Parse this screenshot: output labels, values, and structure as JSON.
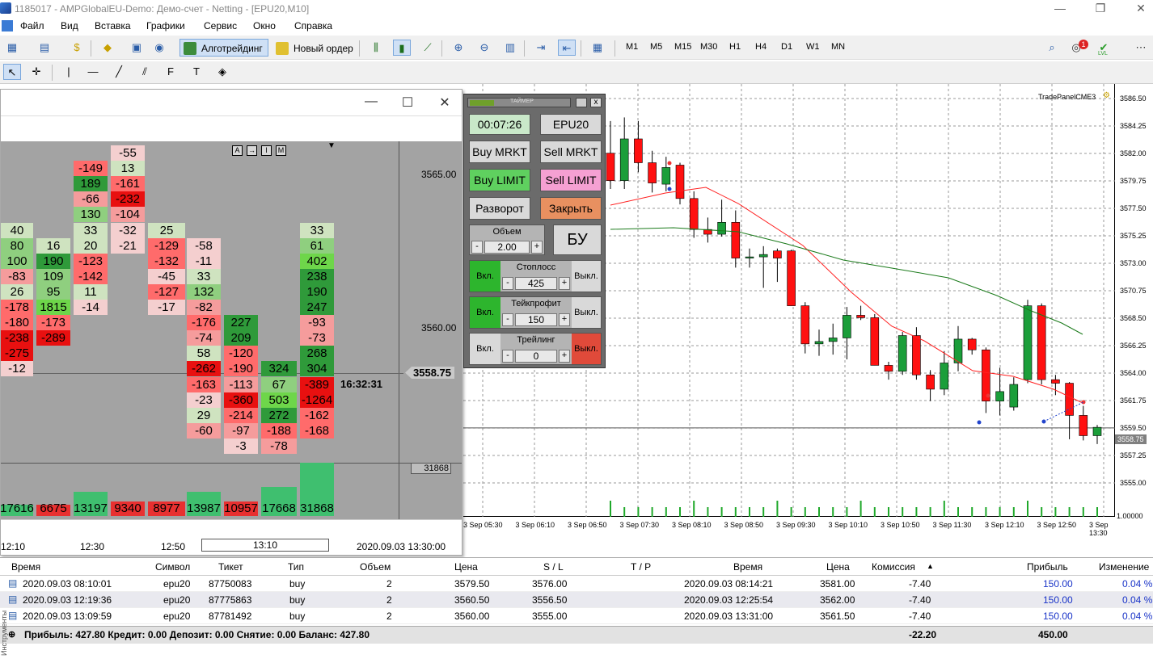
{
  "window": {
    "title": "1185017 - AMPGlobalEU-Demo: Демо-счет - Netting - [EPU20,M10]"
  },
  "menu": [
    "Файл",
    "Вид",
    "Вставка",
    "Графики",
    "Сервис",
    "Окно",
    "Справка"
  ],
  "toolbar": {
    "algotrading": "Алготрейдинг",
    "new_order": "Новый ордер",
    "timeframes": [
      "M1",
      "M5",
      "M15",
      "M30",
      "H1",
      "H4",
      "D1",
      "W1",
      "MN"
    ],
    "notif_count": "1",
    "lvl": "LVL"
  },
  "chart": {
    "tag": "TradePanelCME3",
    "current_price": "3558.75",
    "price_labels": [
      "3586.50",
      "3584.25",
      "3582.00",
      "3579.75",
      "3577.50",
      "3575.25",
      "3573.00",
      "3570.75",
      "3568.50",
      "3566.25",
      "3564.00",
      "3561.75",
      "3559.50",
      "3557.25",
      "3555.00"
    ],
    "volume_axis": "1.00000",
    "time_labels": [
      "3 Sep 05:30",
      "3 Sep 06:10",
      "3 Sep 06:50",
      "3 Sep 07:30",
      "3 Sep 08:10",
      "3 Sep 08:50",
      "3 Sep 09:30",
      "3 Sep 10:10",
      "3 Sep 10:50",
      "3 Sep 11:30",
      "3 Sep 12:10",
      "3 Sep 12:50",
      "3 Sep 13:30"
    ]
  },
  "trade_panel": {
    "timer_label": "ТАЙМЕР",
    "timer": "00:07:26",
    "symbol": "EPU20",
    "buy_market": "Buy MRKT",
    "sell_market": "Sell MRKT",
    "buy_limit": "Buy LIMIT",
    "sell_limit": "Sell LIMIT",
    "reverse": "Разворот",
    "close": "Закрыть",
    "volume_label": "Объем",
    "volume": "2.00",
    "bu": "БУ",
    "on": "Вкл.",
    "off": "Выкл.",
    "stoploss_label": "Стоплосс",
    "stoploss": "425",
    "takeprofit_label": "Тейкпрофит",
    "takeprofit": "150",
    "trailing_label": "Трейлинг",
    "trailing": "0",
    "minus": "-",
    "plus": "+",
    "close_x": "x"
  },
  "footprint": {
    "buttons": [
      "A",
      "→",
      "I",
      "M"
    ],
    "price_top": "3565.00",
    "price_mid": "3560.00",
    "price_current": "3558.75",
    "time_now": "16:32:31",
    "volume_box": "31868",
    "volumes": [
      "17616",
      "6675",
      "13197",
      "9340",
      "8977",
      "13987",
      "10957",
      "17668",
      "31868"
    ],
    "times": [
      "12:10",
      "12:30",
      "12:50",
      "13:10"
    ],
    "datetime": "2020.09.03 13:30:00",
    "columns": [
      [
        "40",
        "80",
        "100",
        "-83",
        "26",
        "-178",
        "-180",
        "-238",
        "-275",
        "-12"
      ],
      [
        "16",
        "190",
        "109",
        "95",
        "1815",
        "-173",
        "-289"
      ],
      [
        "-149",
        "189",
        "-66",
        "130",
        "33",
        "20",
        "-123",
        "-142",
        "11",
        "-14"
      ],
      [
        "-55",
        "13",
        "-161",
        "-232",
        "-104",
        "-32",
        "-21"
      ],
      [
        "25",
        "-129",
        "-132",
        "-45",
        "-127",
        "-17"
      ],
      [
        "-58",
        "-11",
        "33",
        "132",
        "-82",
        "-176",
        "-74",
        "58",
        "-262",
        "-163",
        "-23",
        "29",
        "-60"
      ],
      [
        "227",
        "209",
        "-120",
        "-190",
        "-113",
        "-360",
        "-214",
        "-97",
        "-3"
      ],
      [
        "324",
        "67",
        "503",
        "272",
        "-188",
        "-78"
      ],
      [
        "33",
        "61",
        "402",
        "238",
        "190",
        "247",
        "-93",
        "-73",
        "268",
        "304",
        "-389",
        "-1264",
        "-162",
        "-168"
      ]
    ]
  },
  "terminal": {
    "headers": [
      "Время",
      "Символ",
      "Тикет",
      "Тип",
      "Объем",
      "Цена",
      "S / L",
      "T / P",
      "Время",
      "Цена",
      "Комиссия",
      "Прибыль",
      "Изменение"
    ],
    "rows": [
      {
        "open_time": "2020.09.03 08:10:01",
        "symbol": "epu20",
        "ticket": "87750083",
        "type": "buy",
        "volume": "2",
        "price": "3579.50",
        "sl": "3576.00",
        "tp": "",
        "close_time": "2020.09.03 08:14:21",
        "close_price": "3581.00",
        "commission": "-7.40",
        "profit": "150.00",
        "change": "0.04 %"
      },
      {
        "open_time": "2020.09.03 12:19:36",
        "symbol": "epu20",
        "ticket": "87775863",
        "type": "buy",
        "volume": "2",
        "price": "3560.50",
        "sl": "3556.50",
        "tp": "",
        "close_time": "2020.09.03 12:25:54",
        "close_price": "3562.00",
        "commission": "-7.40",
        "profit": "150.00",
        "change": "0.04 %"
      },
      {
        "open_time": "2020.09.03 13:09:59",
        "symbol": "epu20",
        "ticket": "87781492",
        "type": "buy",
        "volume": "2",
        "price": "3560.00",
        "sl": "3555.00",
        "tp": "",
        "close_time": "2020.09.03 13:31:00",
        "close_price": "3561.50",
        "commission": "-7.40",
        "profit": "150.00",
        "change": "0.04 %"
      }
    ],
    "summary": "Прибыль: 427.80  Кредит: 0.00  Депозит: 0.00  Снятие: 0.00  Баланс: 427.80",
    "total_commission": "-22.20",
    "total_profit": "450.00",
    "side_tab": "Инструменты"
  },
  "candles": [
    {
      "o": 3581.8,
      "h": 3584.5,
      "l": 3578.8,
      "c": 3579.5
    },
    {
      "o": 3579.5,
      "h": 3584.8,
      "l": 3578.8,
      "c": 3583.0
    },
    {
      "o": 3583.0,
      "h": 3584.5,
      "l": 3580.2,
      "c": 3581.0
    },
    {
      "o": 3581.0,
      "h": 3582.0,
      "l": 3578.5,
      "c": 3579.3
    },
    {
      "o": 3579.2,
      "h": 3581.5,
      "l": 3578.6,
      "c": 3580.6
    },
    {
      "o": 3580.8,
      "h": 3581.0,
      "l": 3577.5,
      "c": 3578.0
    },
    {
      "o": 3578.0,
      "h": 3578.6,
      "l": 3574.7,
      "c": 3575.4
    },
    {
      "o": 3575.4,
      "h": 3576.4,
      "l": 3574.3,
      "c": 3575.0
    },
    {
      "o": 3575.0,
      "h": 3577.9,
      "l": 3574.8,
      "c": 3576.0
    },
    {
      "o": 3576.0,
      "h": 3577.0,
      "l": 3572.2,
      "c": 3573.0
    },
    {
      "o": 3573.0,
      "h": 3573.8,
      "l": 3572.2,
      "c": 3573.1
    },
    {
      "o": 3573.1,
      "h": 3574.0,
      "l": 3570.5,
      "c": 3573.3
    },
    {
      "o": 3573.6,
      "h": 3573.8,
      "l": 3571.0,
      "c": 3573.0
    },
    {
      "o": 3573.6,
      "h": 3573.7,
      "l": 3569.0,
      "c": 3569.0
    },
    {
      "o": 3569.0,
      "h": 3569.3,
      "l": 3565.0,
      "c": 3565.8
    },
    {
      "o": 3565.8,
      "h": 3567.0,
      "l": 3564.8,
      "c": 3566.0
    },
    {
      "o": 3566.0,
      "h": 3567.5,
      "l": 3564.9,
      "c": 3566.3
    },
    {
      "o": 3566.3,
      "h": 3568.9,
      "l": 3564.5,
      "c": 3568.2
    },
    {
      "o": 3568.2,
      "h": 3569.0,
      "l": 3567.8,
      "c": 3568.0
    },
    {
      "o": 3568.0,
      "h": 3568.3,
      "l": 3564.0,
      "c": 3564.0
    },
    {
      "o": 3564.0,
      "h": 3564.3,
      "l": 3562.8,
      "c": 3563.5
    },
    {
      "o": 3563.5,
      "h": 3566.8,
      "l": 3563.2,
      "c": 3566.5
    },
    {
      "o": 3566.5,
      "h": 3567.2,
      "l": 3562.8,
      "c": 3563.2
    },
    {
      "o": 3563.2,
      "h": 3563.6,
      "l": 3561.0,
      "c": 3562.0
    },
    {
      "o": 3562.0,
      "h": 3565.2,
      "l": 3561.5,
      "c": 3564.2
    },
    {
      "o": 3564.2,
      "h": 3567.3,
      "l": 3563.5,
      "c": 3566.2
    },
    {
      "o": 3566.2,
      "h": 3566.3,
      "l": 3564.9,
      "c": 3565.3
    },
    {
      "o": 3565.3,
      "h": 3565.5,
      "l": 3560.0,
      "c": 3561.0
    },
    {
      "o": 3561.0,
      "h": 3563.8,
      "l": 3559.8,
      "c": 3561.8
    },
    {
      "o": 3560.5,
      "h": 3563.0,
      "l": 3560.2,
      "c": 3562.4
    },
    {
      "o": 3562.8,
      "h": 3569.5,
      "l": 3562.5,
      "c": 3569.0
    },
    {
      "o": 3569.0,
      "h": 3569.2,
      "l": 3562.4,
      "c": 3562.8
    },
    {
      "o": 3562.8,
      "h": 3563.2,
      "l": 3561.5,
      "c": 3562.5
    },
    {
      "o": 3562.5,
      "h": 3562.6,
      "l": 3557.8,
      "c": 3559.8
    },
    {
      "o": 3559.8,
      "h": 3560.6,
      "l": 3557.7,
      "c": 3558.1
    },
    {
      "o": 3558.1,
      "h": 3559.0,
      "l": 3557.4,
      "c": 3558.8
    },
    {
      "o": 3558.4,
      "h": 3563.5,
      "l": 3557.6,
      "c": 3558.9
    }
  ]
}
